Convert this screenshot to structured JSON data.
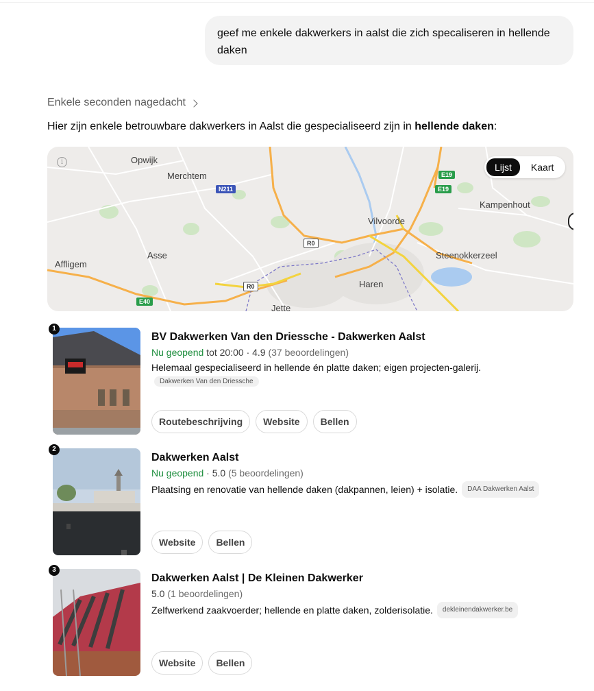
{
  "user_message": "geef me enkele dakwerkers in aalst die zich specaliseren in hellende daken",
  "thinking_label": "Enkele seconden nagedacht",
  "intro": {
    "before": "Hier zijn enkele betrouwbare dakwerkers in Aalst die gespecialiseerd zijn in ",
    "bold": "hellende daken",
    "after": ":"
  },
  "map": {
    "toggle": {
      "list": "Lijst",
      "map": "Kaart"
    },
    "places": [
      "Opwijk",
      "Merchtem",
      "Asse",
      "Affligem",
      "Vilvoorde",
      "Kampenhout",
      "Steenokkerzeel",
      "Haren",
      "Jette"
    ],
    "roads": [
      "N211",
      "E19",
      "E19",
      "R0",
      "R0",
      "E40"
    ]
  },
  "results": [
    {
      "number": "1",
      "name": "BV Dakwerken Van den Driessche - Dakwerken Aalst",
      "status": "Nu geopend",
      "hours": " tot 20:00 · 4.9 ",
      "reviews": "(37 beoordelingen)",
      "description": "Helemaal gespecialiseerd in hellende én platte daken; eigen projecten-galerij.",
      "source": "Dakwerken Van den Driessche",
      "buttons": [
        "Routebeschrijving",
        "Website",
        "Bellen"
      ]
    },
    {
      "number": "2",
      "name": "Dakwerken Aalst",
      "status": "Nu geopend",
      "hours": " · 5.0 ",
      "reviews": "(5 beoordelingen)",
      "description": "Plaatsing en renovatie van hellende daken (dakpannen, leien) + isolatie.",
      "source": "DAA Dakwerken Aalst",
      "buttons": [
        "Website",
        "Bellen"
      ]
    },
    {
      "number": "3",
      "name": "Dakwerken Aalst | De Kleinen Dakwerker",
      "status": "",
      "hours": "5.0 ",
      "reviews": "(1 beoordelingen)",
      "description": "Zelfwerkend zaakvoerder; hellende en platte daken, zolderisolatie.",
      "source": "dekleinendakwerker.be",
      "buttons": [
        "Website",
        "Bellen"
      ]
    }
  ]
}
